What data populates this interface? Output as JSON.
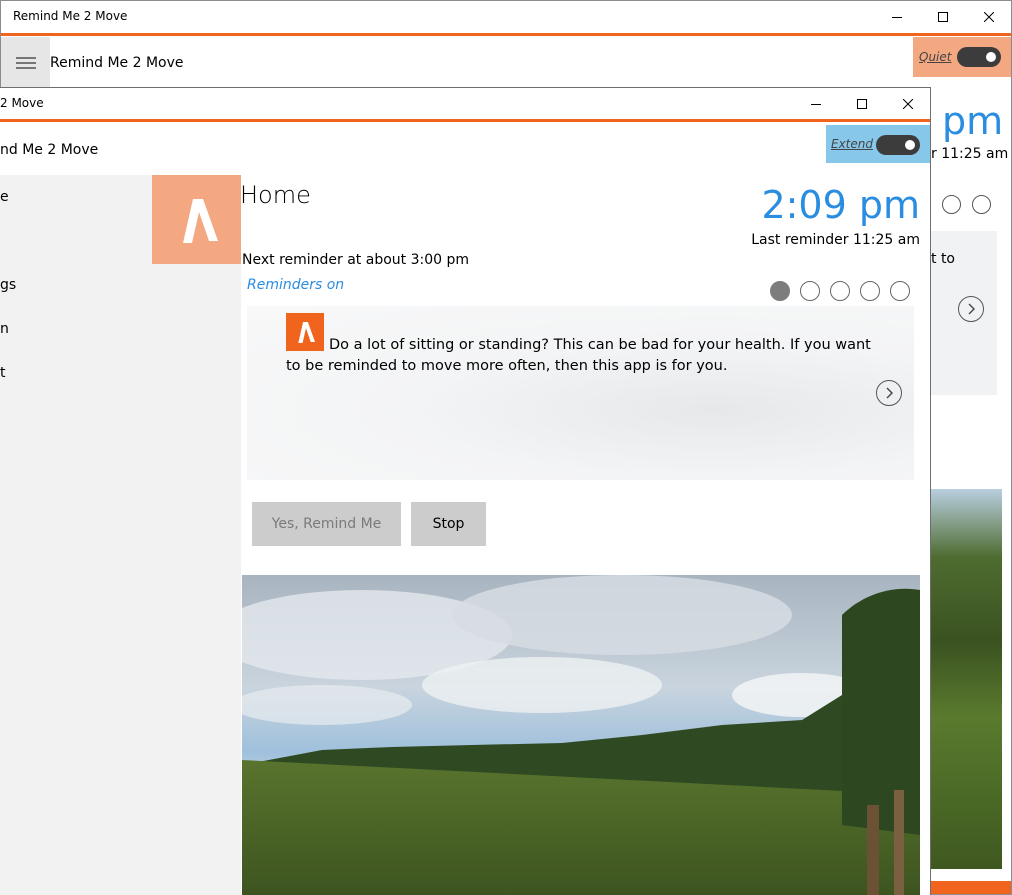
{
  "back_window": {
    "title": "Remind Me 2 Move",
    "app_title": "Remind Me 2 Move",
    "quiet_label": "Quiet",
    "quiet_toggle_on": true,
    "time": "pm",
    "last_reminder": "r 11:25 am",
    "card_text_fragment": "t to"
  },
  "front_window": {
    "title": "2 Move",
    "app_title": "nd Me 2 Move",
    "extend_label": "Extend",
    "extend_toggle_on": true,
    "sidebar": {
      "items": [
        {
          "label": "e"
        },
        {
          "label": "gs"
        },
        {
          "label": "n"
        },
        {
          "label": "t"
        }
      ]
    },
    "main": {
      "page_title": "Home",
      "clock": "2:09 pm",
      "last_reminder": "Last reminder 11:25 am",
      "next_reminder": "Next reminder at about 3:00 pm",
      "reminders_status": "Reminders on",
      "pager": {
        "count": 5,
        "active_index": 0
      },
      "card_text": "Do a lot of sitting or standing? This can be bad for your health. If you want to be reminded to move more often, then this app is for you.",
      "yes_button": "Yes, Remind Me",
      "stop_button": "Stop"
    }
  },
  "colors": {
    "accent_orange": "#f0641e",
    "peach": "#f4a882",
    "sky_blue": "#87c8ea",
    "time_blue": "#2b8de0"
  }
}
